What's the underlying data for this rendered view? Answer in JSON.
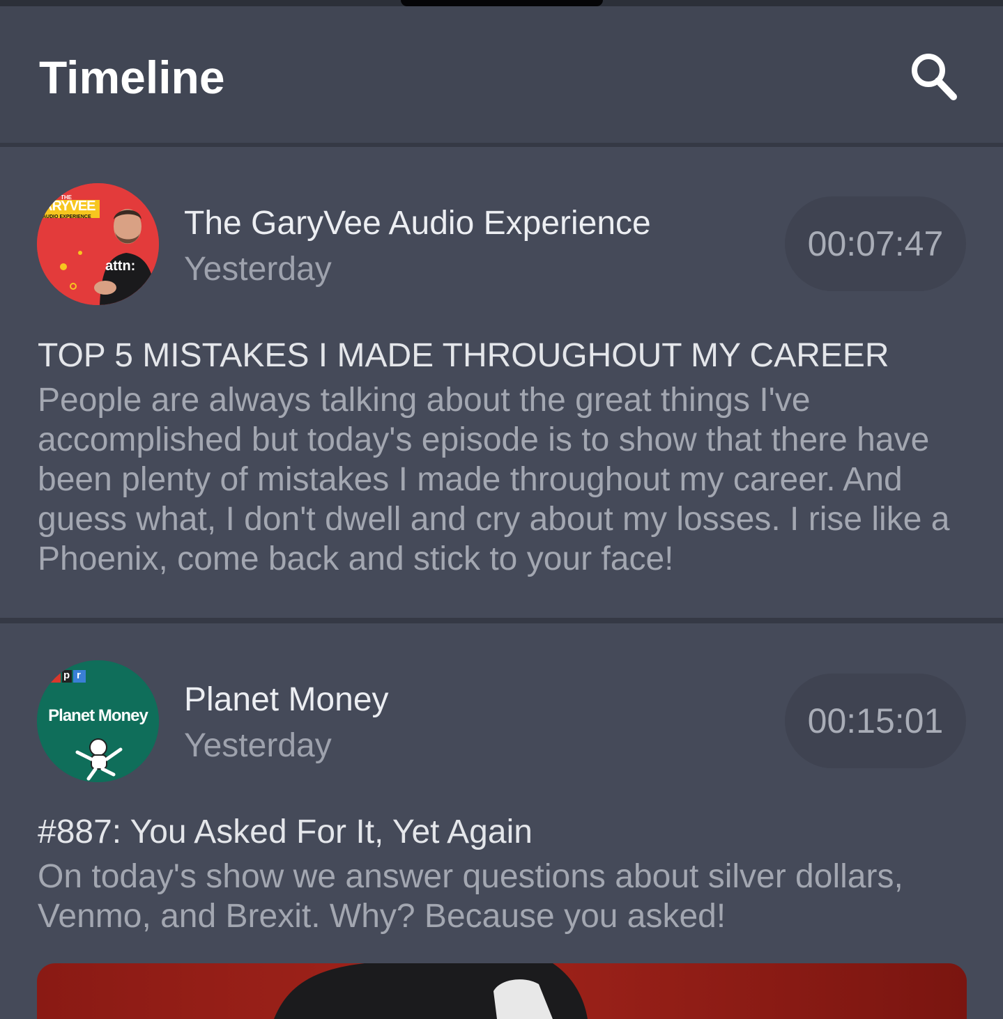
{
  "appbar": {
    "title": "Timeline",
    "search_icon": "search-icon"
  },
  "colors": {
    "background": "#454a59",
    "appbar": "#414654",
    "divider": "#353945",
    "duration_pill": "#3f4351"
  },
  "episodes": [
    {
      "podcast": "The GaryVee Audio Experience",
      "date": "Yesterday",
      "duration": "00:07:47",
      "title": "TOP 5 MISTAKES I MADE THROUGHOUT MY CAREER",
      "description": "People are always talking about the great things I've accomplished but today's episode is to show that there have been plenty of mistakes I made throughout my career. And guess what, I don't dwell and cry about my losses. I rise like a Phoenix, come back and stick to your face!",
      "artwork": {
        "brand_top": "THE",
        "brand_main": "ARYVEE",
        "brand_sub": "AUDIO EXPERIENCE",
        "shirt_text": "attn:"
      }
    },
    {
      "podcast": "Planet Money",
      "date": "Yesterday",
      "duration": "00:15:01",
      "title": "#887: You Asked For It, Yet Again",
      "description": "On today's show we answer questions about silver dollars, Venmo, and Brexit. Why? Because you asked!",
      "artwork": {
        "npr_letters": [
          "p",
          "r"
        ],
        "title": "Planet Money"
      }
    }
  ]
}
